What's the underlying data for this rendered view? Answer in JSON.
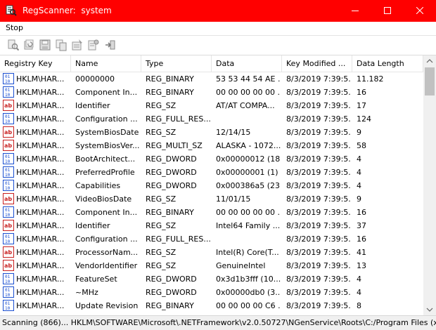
{
  "window": {
    "title": "RegScanner:  system"
  },
  "menu": {
    "items": [
      "Stop"
    ]
  },
  "toolbar": {
    "icons": [
      "find-icon",
      "refresh-icon",
      "save-icon",
      "copy-icon",
      "properties-icon",
      "export-icon",
      "exit-icon"
    ]
  },
  "columns": [
    "Registry Key",
    "Name",
    "Type",
    "Data",
    "Key Modified ...",
    "Data Length"
  ],
  "rows": [
    {
      "icon": "binary-value-icon",
      "key": "HKLM\\HAR...",
      "name": "00000000",
      "type": "REG_BINARY",
      "data": "53 53 44 54 AE ...",
      "modified": "8/3/2019 7:39:5...",
      "length": "11.182"
    },
    {
      "icon": "binary-value-icon",
      "key": "HKLM\\HAR...",
      "name": "Component In...",
      "type": "REG_BINARY",
      "data": "00 00 00 00 00 ...",
      "modified": "8/3/2019 7:39:5...",
      "length": "16"
    },
    {
      "icon": "string-value-icon",
      "key": "HKLM\\HAR...",
      "name": "Identifier",
      "type": "REG_SZ",
      "data": "AT/AT COMPA...",
      "modified": "8/3/2019 7:39:5...",
      "length": "17"
    },
    {
      "icon": "binary-value-icon",
      "key": "HKLM\\HAR...",
      "name": "Configuration ...",
      "type": "REG_FULL_RES...",
      "data": "",
      "modified": "8/3/2019 7:39:5...",
      "length": "124"
    },
    {
      "icon": "string-value-icon",
      "key": "HKLM\\HAR...",
      "name": "SystemBiosDate",
      "type": "REG_SZ",
      "data": "12/14/15",
      "modified": "8/3/2019 7:39:5...",
      "length": "9"
    },
    {
      "icon": "string-value-icon",
      "key": "HKLM\\HAR...",
      "name": "SystemBiosVer...",
      "type": "REG_MULTI_SZ",
      "data": "ALASKA - 1072...",
      "modified": "8/3/2019 7:39:5...",
      "length": "58"
    },
    {
      "icon": "binary-value-icon",
      "key": "HKLM\\HAR...",
      "name": "BootArchitect...",
      "type": "REG_DWORD",
      "data": "0x00000012 (18)",
      "modified": "8/3/2019 7:39:5...",
      "length": "4"
    },
    {
      "icon": "binary-value-icon",
      "key": "HKLM\\HAR...",
      "name": "PreferredProfile",
      "type": "REG_DWORD",
      "data": "0x00000001 (1)",
      "modified": "8/3/2019 7:39:5...",
      "length": "4"
    },
    {
      "icon": "binary-value-icon",
      "key": "HKLM\\HAR...",
      "name": "Capabilities",
      "type": "REG_DWORD",
      "data": "0x000386a5 (23...",
      "modified": "8/3/2019 7:39:5...",
      "length": "4"
    },
    {
      "icon": "string-value-icon",
      "key": "HKLM\\HAR...",
      "name": "VideoBiosDate",
      "type": "REG_SZ",
      "data": "11/01/15",
      "modified": "8/3/2019 7:39:5...",
      "length": "9"
    },
    {
      "icon": "binary-value-icon",
      "key": "HKLM\\HAR...",
      "name": "Component In...",
      "type": "REG_BINARY",
      "data": "00 00 00 00 00 ...",
      "modified": "8/3/2019 7:39:5...",
      "length": "16"
    },
    {
      "icon": "string-value-icon",
      "key": "HKLM\\HAR...",
      "name": "Identifier",
      "type": "REG_SZ",
      "data": "Intel64 Family ...",
      "modified": "8/3/2019 7:39:5...",
      "length": "37"
    },
    {
      "icon": "binary-value-icon",
      "key": "HKLM\\HAR...",
      "name": "Configuration ...",
      "type": "REG_FULL_RES...",
      "data": "",
      "modified": "8/3/2019 7:39:5...",
      "length": "16"
    },
    {
      "icon": "string-value-icon",
      "key": "HKLM\\HAR...",
      "name": "ProcessorNam...",
      "type": "REG_SZ",
      "data": "Intel(R) Core(T...",
      "modified": "8/3/2019 7:39:5...",
      "length": "41"
    },
    {
      "icon": "string-value-icon",
      "key": "HKLM\\HAR...",
      "name": "VendorIdentifier",
      "type": "REG_SZ",
      "data": "GenuineIntel",
      "modified": "8/3/2019 7:39:5...",
      "length": "13"
    },
    {
      "icon": "binary-value-icon",
      "key": "HKLM\\HAR...",
      "name": "FeatureSet",
      "type": "REG_DWORD",
      "data": "0x3d1b3fff (10...",
      "modified": "8/3/2019 7:39:5...",
      "length": "4"
    },
    {
      "icon": "binary-value-icon",
      "key": "HKLM\\HAR...",
      "name": "~MHz",
      "type": "REG_DWORD",
      "data": "0x00000db0 (3...",
      "modified": "8/3/2019 7:39:5...",
      "length": "4"
    },
    {
      "icon": "binary-value-icon",
      "key": "HKLM\\HAR...",
      "name": "Update Revision",
      "type": "REG_BINARY",
      "data": "00 00 00 00 C6 ...",
      "modified": "8/3/2019 7:39:5...",
      "length": "8"
    }
  ],
  "status": {
    "text": "Scanning (866)... HKLM\\SOFTWARE\\Microsoft\\.NETFramework\\v2.0.50727\\NGenService\\Roots\\C:/Program Files (x"
  },
  "colors": {
    "titlebar": "#ff0000",
    "binary_icon": "#1a4fd1",
    "string_icon": "#c82020"
  }
}
